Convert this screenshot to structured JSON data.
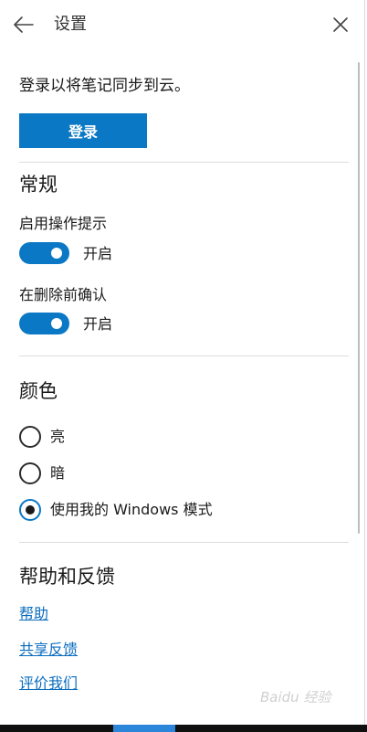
{
  "header": {
    "title": "设置"
  },
  "account": {
    "sync_text": "登录以将笔记同步到云。",
    "login_label": "登录"
  },
  "general": {
    "title": "常规",
    "tips": {
      "label": "启用操作提示",
      "state": "开启",
      "on": true
    },
    "confirm_delete": {
      "label": "在删除前确认",
      "state": "开启",
      "on": true
    }
  },
  "color": {
    "title": "颜色",
    "options": [
      {
        "label": "亮",
        "selected": false
      },
      {
        "label": "暗",
        "selected": false
      },
      {
        "label": "使用我的 Windows 模式",
        "selected": true
      }
    ]
  },
  "help": {
    "title": "帮助和反馈",
    "links": [
      "帮助",
      "共享反馈",
      "评价我们"
    ]
  },
  "watermark": "Baidu 经验",
  "colors": {
    "accent": "#0a78c4",
    "link": "#0a6cbf"
  }
}
